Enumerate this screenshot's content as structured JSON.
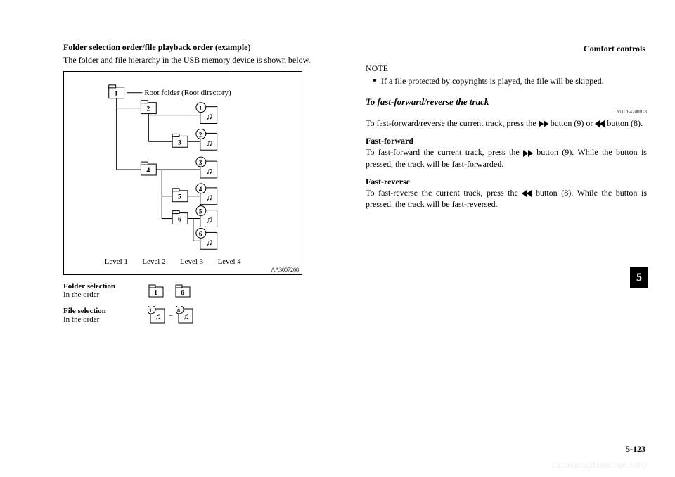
{
  "header": {
    "section": "Comfort controls"
  },
  "left": {
    "title": "Folder selection order/file playback order (example)",
    "intro": "The folder and file hierarchy in the USB memory device is shown below.",
    "diagram": {
      "root_label": "Root folder (Root directory)",
      "levels": [
        "Level 1",
        "Level 2",
        "Level 3",
        "Level 4"
      ],
      "img_id": "AA3007268",
      "folders": [
        "1",
        "2",
        "3",
        "4",
        "5",
        "6"
      ],
      "files": [
        "1",
        "2",
        "3",
        "4",
        "5",
        "6"
      ]
    },
    "legend": {
      "folder_title": "Folder selection",
      "folder_sub": "In the order",
      "folder_range": [
        "1",
        "6"
      ],
      "file_title": "File selection",
      "file_sub": "In the order",
      "file_range": [
        "1",
        "6"
      ],
      "dash": "–"
    }
  },
  "right": {
    "note_label": "NOTE",
    "note_bullet": "If a file protected by copyrights is played, the file will be skipped.",
    "ff_heading": "To fast-forward/reverse the track",
    "ff_code": "N00764200018",
    "ff_intro_a": "To fast-forward/reverse the current track, press the ",
    "ff_intro_b": " button (9) or ",
    "ff_intro_c": " button (8).",
    "ff_sub": "Fast-forward",
    "ff_body": "To fast-forward the current track, press the  button (9). While the button is pressed, the track will be fast-forwarded.",
    "fr_sub": "Fast-reverse",
    "fr_body": "To fast-reverse the current track, press the  button (8). While the button is pressed, the track will be fast-reversed."
  },
  "side_tab": "5",
  "page_num": "5-123",
  "watermark": "carmanualsonline.info"
}
